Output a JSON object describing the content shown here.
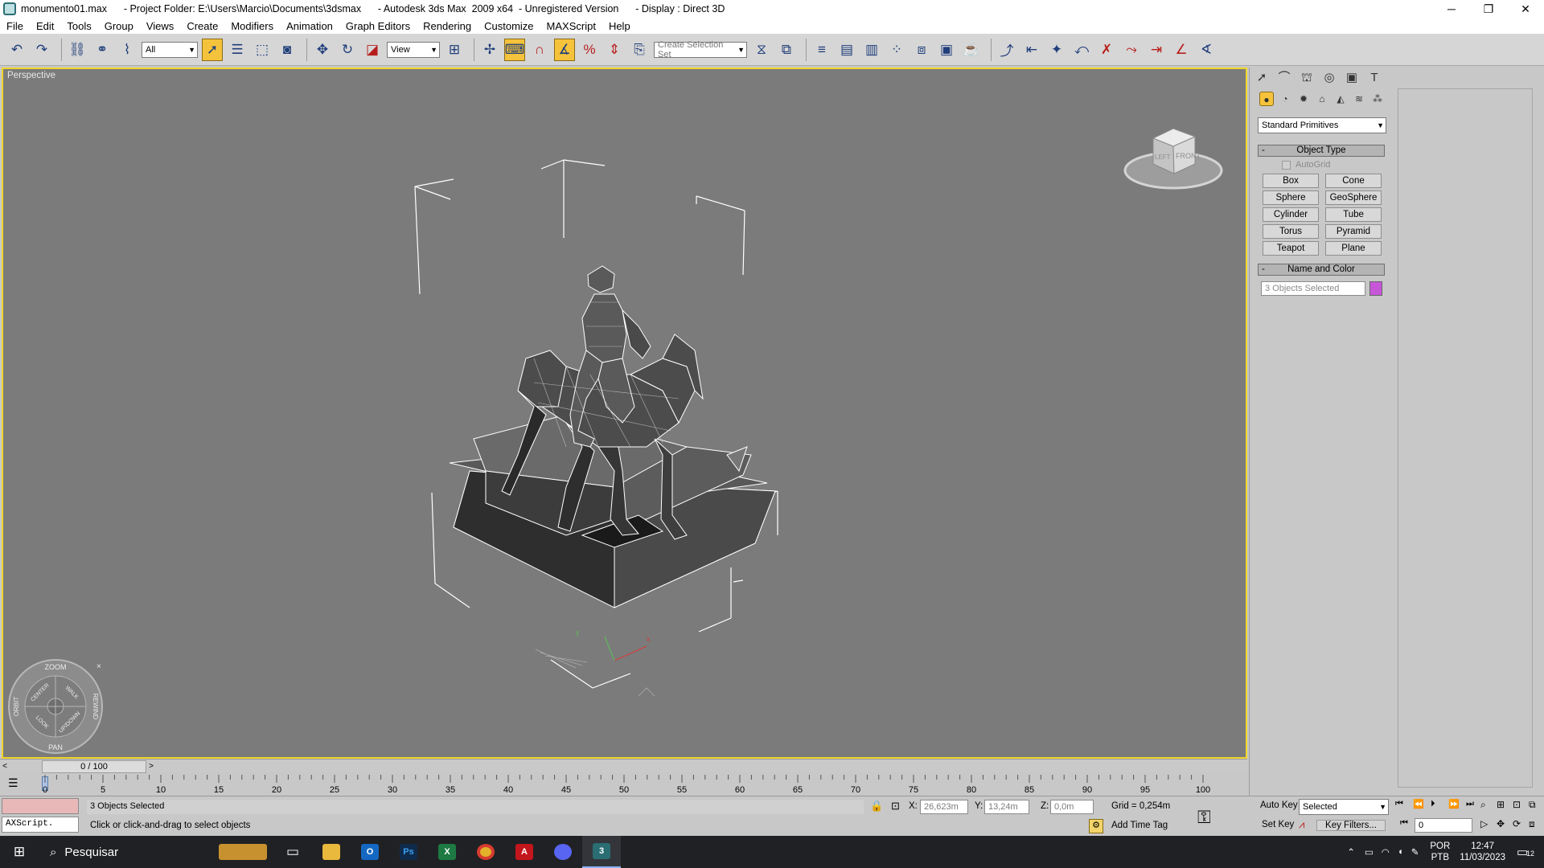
{
  "window": {
    "title": "monumento01.max      - Project Folder: E:\\Users\\Marcio\\Documents\\3dsmax      - Autodesk 3ds Max  2009 x64  - Unregistered Version      - Display : Direct 3D",
    "min_glyph": "─",
    "max_glyph": "❐",
    "close_glyph": "✕"
  },
  "menu": [
    "File",
    "Edit",
    "Tools",
    "Group",
    "Views",
    "Create",
    "Modifiers",
    "Animation",
    "Graph Editors",
    "Rendering",
    "Customize",
    "MAXScript",
    "Help"
  ],
  "toolbar": {
    "filter_value": "All",
    "refcoord_value": "View",
    "selection_set_placeholder": "Create Selection Set"
  },
  "viewport": {
    "label": "Perspective",
    "viewcube_left": "LEFT",
    "viewcube_front": "FRONT",
    "navwheel": {
      "zoom": "ZOOM",
      "orbit": "ORBIT",
      "pan": "PAN",
      "rewind": "REWIND",
      "center": "CENTER",
      "walk": "WALK",
      "look": "LOOK",
      "updown": "UP/DOWN"
    }
  },
  "timeline": {
    "slider_label": "0 / 100",
    "ticks": [
      "0",
      "5",
      "10",
      "15",
      "20",
      "25",
      "30",
      "35",
      "40",
      "45",
      "50",
      "55",
      "60",
      "65",
      "70",
      "75",
      "80",
      "85",
      "90",
      "95",
      "100"
    ]
  },
  "status": {
    "maxscript_label": "AXScript.",
    "selection_text": "3 Objects Selected",
    "prompt_text": "Click or click-and-drag to select objects",
    "x_label": "X:",
    "x_value": "26,623m",
    "y_label": "Y:",
    "y_value": "13,24m",
    "z_label": "Z:",
    "z_value": "0,0m",
    "grid_text": "Grid = 0,254m",
    "add_time_tag": "Add Time Tag"
  },
  "animation": {
    "auto_key": "Auto Key",
    "selected_value": "Selected",
    "set_key": "Set Key",
    "key_filters": "Key Filters...",
    "frame_value": "0"
  },
  "command_panel": {
    "category_value": "Standard Primitives",
    "object_type_header": "Object Type",
    "autogrid_label": "AutoGrid",
    "primitives": [
      "Box",
      "Cone",
      "Sphere",
      "GeoSphere",
      "Cylinder",
      "Tube",
      "Torus",
      "Pyramid",
      "Teapot",
      "Plane"
    ],
    "name_color_header": "Name and Color",
    "name_value": "3 Objects Selected",
    "object_color": "#c658d8"
  },
  "taskbar": {
    "search_text": "Pesquisar",
    "lang_top": "POR",
    "lang_bottom": "PTB",
    "time": "12:47",
    "date": "11/03/2023",
    "notif_count": "12"
  }
}
